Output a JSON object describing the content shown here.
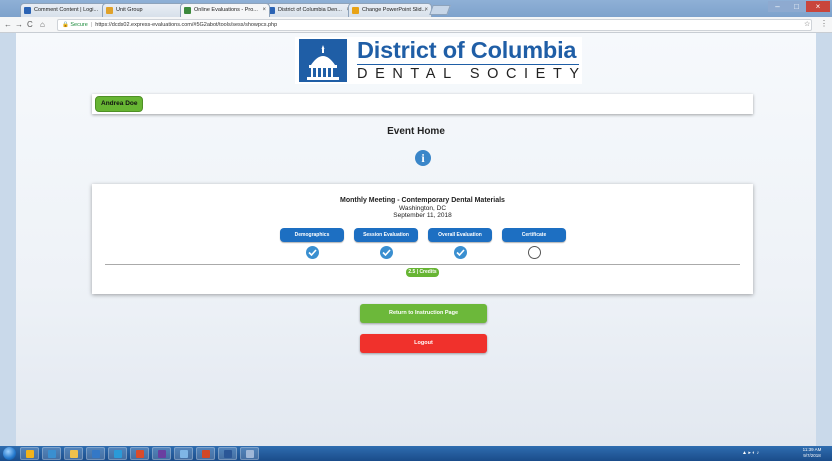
{
  "browser": {
    "tabs": [
      {
        "label": "Comment Content | Logi..."
      },
      {
        "label": "Unit Group"
      },
      {
        "label": "Online Evaluations - Pro..."
      },
      {
        "label": "District of Columbia Den..."
      },
      {
        "label": "Change PowerPoint Slid..."
      }
    ],
    "address": {
      "secure_label": "Secure",
      "url": "https://dcds02.express-evaluations.com/#5G2abot/tools/sess/showpcs.php"
    }
  },
  "logo": {
    "title": "District of Columbia",
    "subtitle": "DENTAL SOCIETY"
  },
  "user": {
    "name": "Andrea Doe"
  },
  "page": {
    "heading": "Event Home",
    "info_glyph": "i"
  },
  "event": {
    "title": "Monthly Meeting - Contemporary Dental Materials",
    "location": "Washington, DC",
    "date": "September 11, 2018",
    "steps": [
      {
        "label": "Demographics",
        "status": "complete",
        "status_icon": "check-circle-icon"
      },
      {
        "label": "Session Evaluation",
        "status": "complete",
        "status_icon": "check-circle-icon"
      },
      {
        "label": "Overall Evaluation",
        "status": "complete",
        "status_icon": "check-circle-icon"
      },
      {
        "label": "Certificate",
        "status": "incomplete",
        "status_icon": "empty-circle-icon"
      }
    ],
    "credits": "2.5 | Credits"
  },
  "actions": {
    "return_label": "Return to Instruction Page",
    "logout_label": "Logout"
  },
  "taskbar": {
    "tray": "▲ ▸ ◐ ♪",
    "time": "11:39 AM",
    "date": "9/7/2018"
  },
  "colors": {
    "brand_blue": "#1f5ea6",
    "step_blue": "#1d6fc2",
    "green": "#67b533",
    "red": "#f0312c"
  }
}
